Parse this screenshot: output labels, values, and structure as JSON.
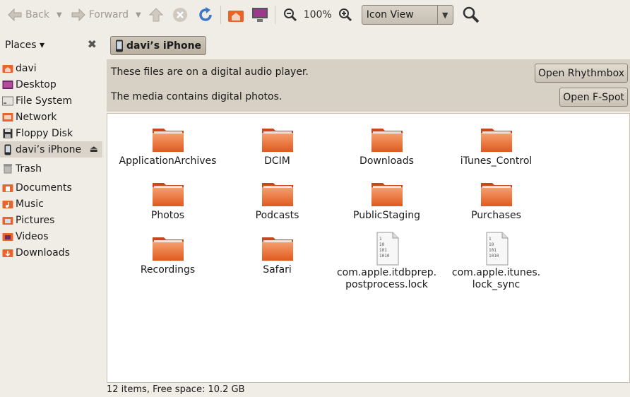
{
  "toolbar": {
    "back_label": "Back",
    "forward_label": "Forward",
    "zoom_level": "100%",
    "view_mode": "Icon View"
  },
  "sidebar": {
    "header_label": "Places ▾",
    "groups": [
      [
        {
          "label": "davi",
          "icon": "home-folder-icon"
        },
        {
          "label": "Desktop",
          "icon": "desktop-icon"
        },
        {
          "label": "File System",
          "icon": "filesystem-icon"
        },
        {
          "label": "Network",
          "icon": "network-icon"
        },
        {
          "label": "Floppy Disk",
          "icon": "floppy-icon"
        },
        {
          "label": "davi’s iPhone",
          "icon": "iphone-icon",
          "active": true,
          "ejectable": true
        }
      ],
      [
        {
          "label": "Trash",
          "icon": "trash-icon"
        }
      ],
      [
        {
          "label": "Documents",
          "icon": "documents-folder-icon"
        },
        {
          "label": "Music",
          "icon": "music-folder-icon"
        },
        {
          "label": "Pictures",
          "icon": "pictures-folder-icon"
        },
        {
          "label": "Videos",
          "icon": "videos-folder-icon"
        },
        {
          "label": "Downloads",
          "icon": "downloads-folder-icon"
        }
      ]
    ]
  },
  "pathbar": {
    "current": "davi’s iPhone"
  },
  "infobar": {
    "audio_message": "These files are on a digital audio player.",
    "audio_button": "Open Rhythmbox",
    "photo_message": "The media contains digital photos.",
    "photo_button": "Open F-Spot"
  },
  "files": [
    {
      "name": "ApplicationArchives",
      "type": "folder"
    },
    {
      "name": "DCIM",
      "type": "folder"
    },
    {
      "name": "Downloads",
      "type": "folder"
    },
    {
      "name": "iTunes_Control",
      "type": "folder"
    },
    {
      "name": "Photos",
      "type": "folder"
    },
    {
      "name": "Podcasts",
      "type": "folder"
    },
    {
      "name": "PublicStaging",
      "type": "folder"
    },
    {
      "name": "Purchases",
      "type": "folder"
    },
    {
      "name": "Recordings",
      "type": "folder"
    },
    {
      "name": "Safari",
      "type": "folder"
    },
    {
      "name": "com.apple.itdbprep.\npostprocess.lock",
      "type": "binary"
    },
    {
      "name": "com.apple.itunes.\nlock_sync",
      "type": "binary"
    }
  ],
  "status": {
    "text": "12 items, Free space: 10.2 GB"
  },
  "colors": {
    "folder_orange": "#e8642a",
    "window_bg": "#f0ece6",
    "infobar_bg": "#d7d0c4"
  }
}
